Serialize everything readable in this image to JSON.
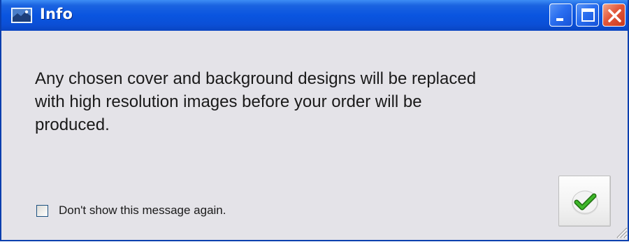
{
  "window": {
    "title": "Info",
    "app_icon": "app-window-icon",
    "controls": {
      "minimize_icon": "minimize-icon",
      "maximize_icon": "maximize-icon",
      "close_icon": "close-icon"
    }
  },
  "dialog": {
    "message_lines": [
      "Any chosen cover and background designs will be replaced",
      "with high resolution images before your order will be",
      "produced."
    ],
    "checkbox": {
      "label": "Don't show this message again.",
      "checked": false
    },
    "ok_button_icon": "checkmark-icon"
  },
  "colors": {
    "titlebar": "#0a55e0",
    "dialog_background": "#e4e3e8",
    "close_button": "#e2583c",
    "checkmark": "#2f8f1a"
  }
}
